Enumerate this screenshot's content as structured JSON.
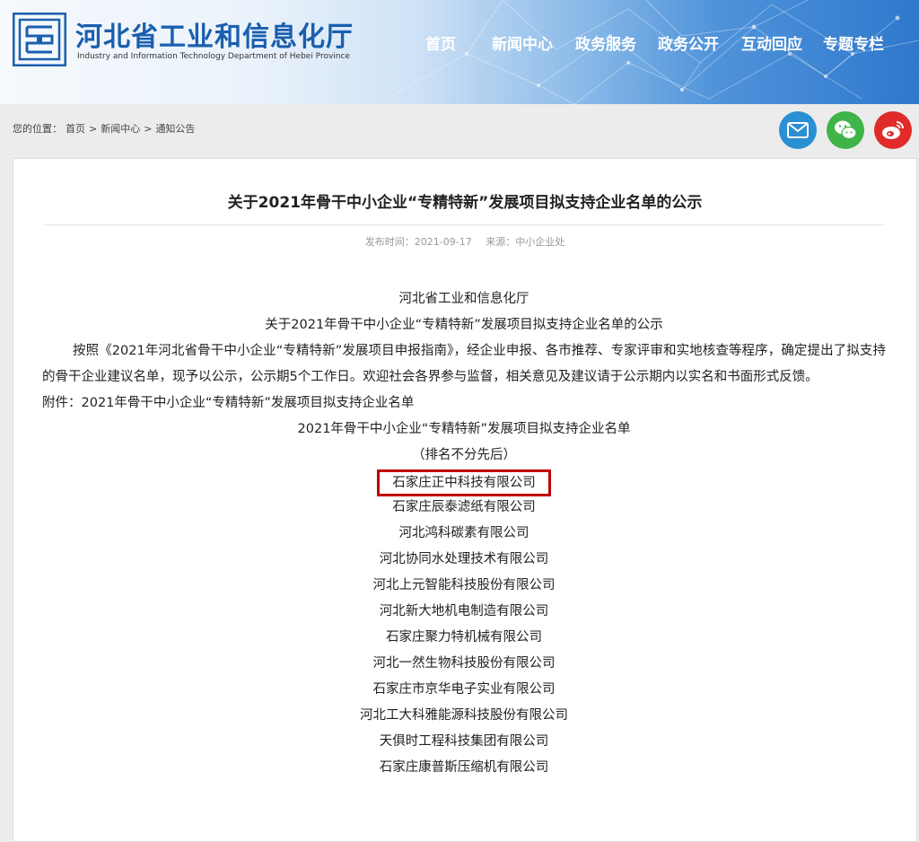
{
  "header": {
    "org_cn": "河北省工业和信息化厅",
    "org_en": "Industry and Information Technology Department of Hebei Province",
    "nav": [
      "首页",
      "新闻中心",
      "政务服务",
      "政务公开",
      "互动回应",
      "专题专栏"
    ]
  },
  "breadcrumb": {
    "prefix": "您的位置：",
    "items": [
      "首页",
      ">",
      "新闻中心",
      ">",
      "通知公告"
    ]
  },
  "share": {
    "icons": [
      "email-icon",
      "wechat-icon",
      "weibo-icon"
    ],
    "colors": [
      "#2b8fd4",
      "#3fb449",
      "#e02b28"
    ]
  },
  "article": {
    "title": "关于2021年骨干中小企业“专精特新”发展项目拟支持企业名单的公示",
    "publish_time": "发布时间：2021-09-17",
    "source": "来源：中小企业处",
    "issuer": "河北省工业和信息化厅",
    "subtitle": "关于2021年骨干中小企业“专精特新”发展项目拟支持企业名单的公示",
    "paragraph": "按照《2021年河北省骨干中小企业“专精特新”发展项目申报指南》，经企业申报、各市推荐、专家评审和实地核查等程序，确定提出了拟支持的骨干企业建议名单，现予以公示，公示期5个工作日。欢迎社会各界参与监督，相关意见及建议请于公示期内以实名和书面形式反馈。",
    "attachment": "附件：2021年骨干中小企业“专精特新”发展项目拟支持企业名单",
    "list_title": "2021年骨干中小企业“专精特新”发展项目拟支持企业名单",
    "list_note": "（排名不分先后）",
    "highlight_color": "#c00000",
    "companies": [
      "石家庄正中科技有限公司",
      "石家庄辰泰滤纸有限公司",
      "河北鸿科碳素有限公司",
      "河北协同水处理技术有限公司",
      "河北上元智能科技股份有限公司",
      "河北新大地机电制造有限公司",
      "石家庄聚力特机械有限公司",
      "河北一然生物科技股份有限公司",
      "石家庄市京华电子实业有限公司",
      "河北工大科雅能源科技股份有限公司",
      "天俱时工程科技集团有限公司",
      "石家庄康普斯压缩机有限公司"
    ]
  }
}
